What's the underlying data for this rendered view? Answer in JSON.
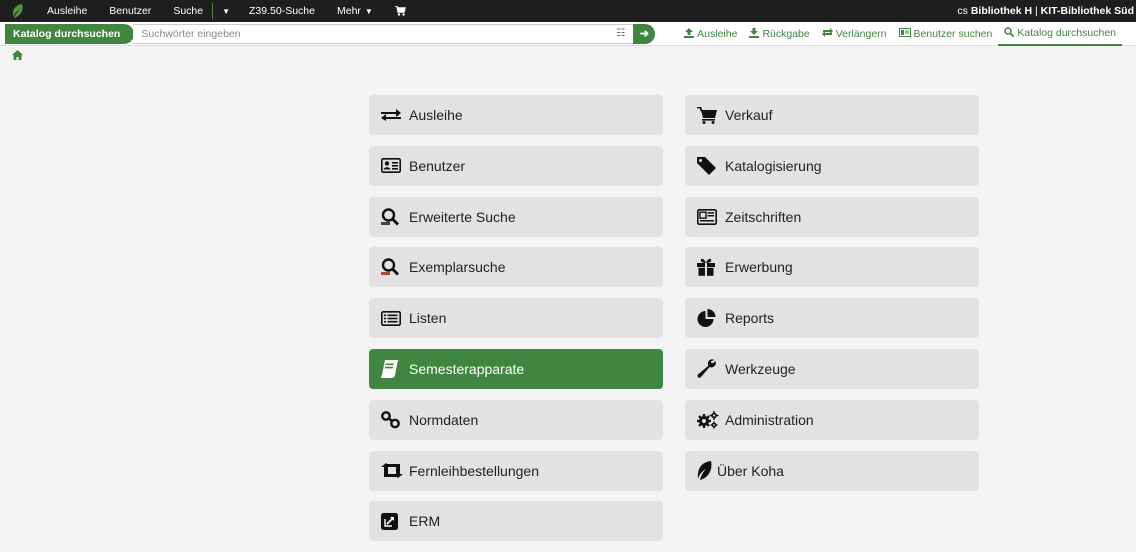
{
  "topnav": {
    "items": [
      "Ausleihe",
      "Benutzer",
      "Suche",
      "Z39.50-Suche",
      "Mehr"
    ],
    "right_prefix": "cs",
    "library": "Bibliothek H",
    "separator": "|",
    "branch": "KIT-Bibliothek Süd"
  },
  "search": {
    "scope_label": "Katalog durchsuchen",
    "placeholder": "Suchwörter eingeben",
    "options_glyph": "☷",
    "go_glyph": "➜"
  },
  "quick_links": [
    {
      "icon": "upload-icon",
      "label": "Ausleihe"
    },
    {
      "icon": "download-icon",
      "label": "Rückgabe"
    },
    {
      "icon": "renew-icon",
      "label": "Verlängern"
    },
    {
      "icon": "id-card-icon",
      "label": "Benutzer suchen"
    },
    {
      "icon": "search-icon",
      "label": "Katalog durchsuchen"
    }
  ],
  "modules_left": [
    {
      "icon": "exchange-icon",
      "label": "Ausleihe"
    },
    {
      "icon": "id-card-icon",
      "label": "Benutzer"
    },
    {
      "icon": "advanced-search-icon",
      "label": "Erweiterte Suche"
    },
    {
      "icon": "item-search-icon",
      "label": "Exemplarsuche"
    },
    {
      "icon": "list-icon",
      "label": "Listen"
    },
    {
      "icon": "book-icon",
      "label": "Semesterapparate",
      "active": true
    },
    {
      "icon": "link-icon",
      "label": "Normdaten"
    },
    {
      "icon": "retweet-icon",
      "label": "Fernleihbestellungen"
    },
    {
      "icon": "external-link-icon",
      "label": "ERM"
    }
  ],
  "modules_right": [
    {
      "icon": "cart-icon",
      "label": "Verkauf"
    },
    {
      "icon": "tag-icon",
      "label": "Katalogisierung"
    },
    {
      "icon": "newspaper-icon",
      "label": "Zeitschriften"
    },
    {
      "icon": "gift-icon",
      "label": "Erwerbung"
    },
    {
      "icon": "pie-chart-icon",
      "label": "Reports"
    },
    {
      "icon": "wrench-icon",
      "label": "Werkzeuge"
    },
    {
      "icon": "cogs-icon",
      "label": "Administration"
    },
    {
      "icon": "koha-leaf-icon",
      "label": "Über Koha"
    }
  ],
  "colors": {
    "accent": "#408540",
    "navbar": "#1e1e1e",
    "tile": "#e2e2e2"
  }
}
